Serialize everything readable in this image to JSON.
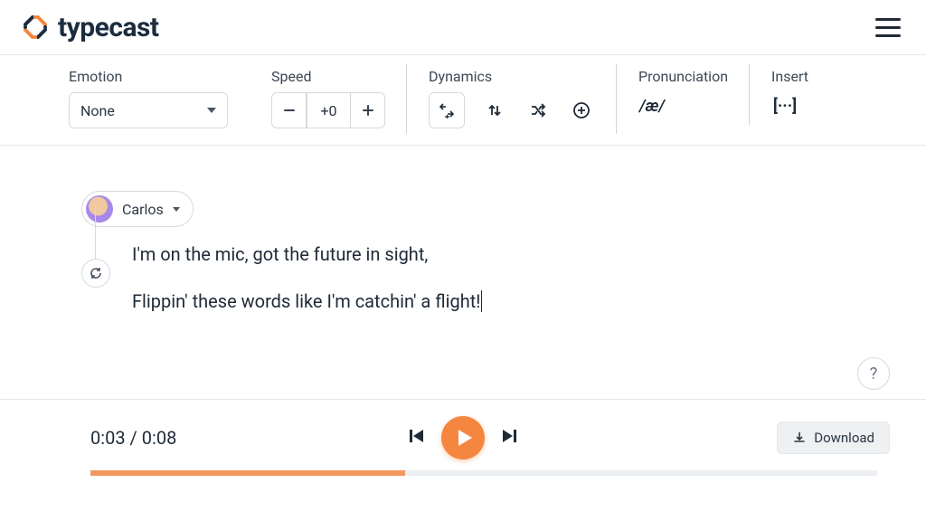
{
  "brand": {
    "name": "typecast"
  },
  "toolbar": {
    "emotion": {
      "label": "Emotion",
      "value": "None"
    },
    "speed": {
      "label": "Speed",
      "value": "+0"
    },
    "dynamics": {
      "label": "Dynamics"
    },
    "pronunciation": {
      "label": "Pronunciation",
      "symbol": "/æ/"
    },
    "insert": {
      "label": "Insert",
      "symbol": "[···]"
    }
  },
  "voice": {
    "name": "Carlos"
  },
  "script": {
    "line1": "I'm on the mic, got the future in sight,",
    "line2": "Flippin' these words like I'm catchin' a flight!"
  },
  "player": {
    "current": "0:03",
    "total": "0:08",
    "progress_percent": 40,
    "download_label": "Download"
  },
  "help": {
    "label": "?"
  },
  "colors": {
    "accent": "#f5863f"
  }
}
